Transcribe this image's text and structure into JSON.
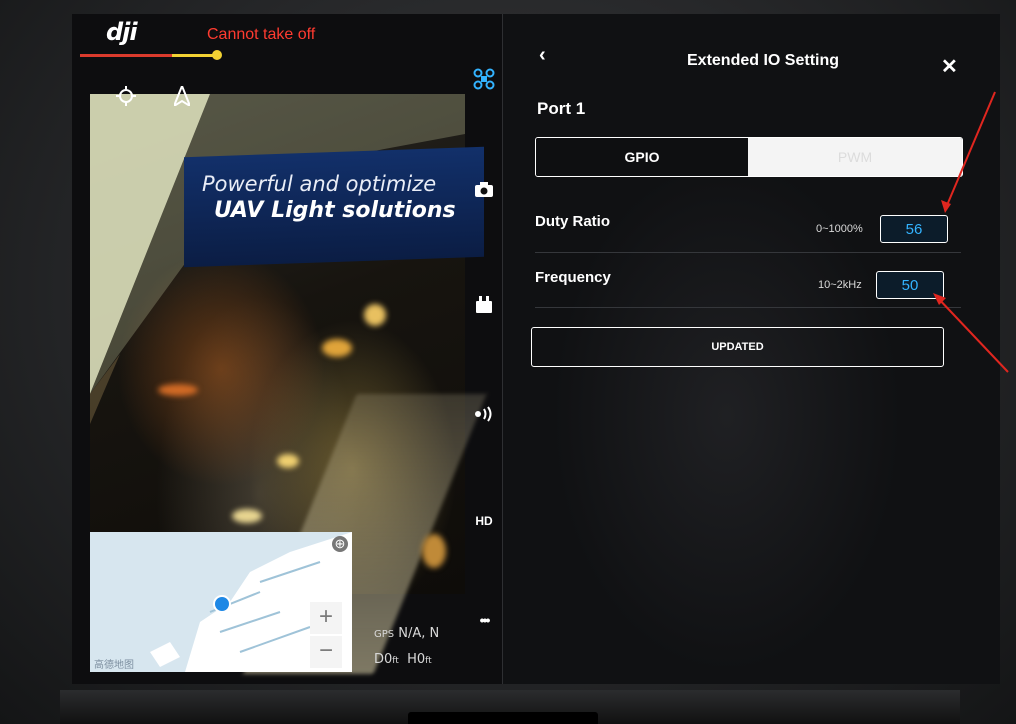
{
  "top_bar": {
    "logo": "dji",
    "status": "Cannot take off",
    "status_color": "#ff3b30"
  },
  "video": {
    "banner_line1": "Powerful and optimize",
    "banner_line2": "UAV Light solutions"
  },
  "sidebar_icons": [
    {
      "name": "aircraft-icon"
    },
    {
      "name": "camera-icon"
    },
    {
      "name": "battery-icon"
    },
    {
      "name": "signal-icon"
    },
    {
      "name": "hd-icon",
      "label": "HD"
    },
    {
      "name": "more-icon",
      "label": "•••"
    }
  ],
  "map": {
    "zoom_in": "+",
    "zoom_out": "−",
    "credit": "高德地图"
  },
  "telemetry": {
    "gps_label": "GPS",
    "gps_value": "N/A, N",
    "d_label": "D",
    "d_value": "0",
    "d_unit": "ft",
    "h_label": "H",
    "h_value": "0",
    "h_unit": "ft"
  },
  "panel": {
    "back": "‹",
    "title": "Extended IO Setting",
    "close": "✕",
    "port": "Port 1",
    "modes": [
      "GPIO",
      "PWM"
    ],
    "selected_mode": "GPIO",
    "duty": {
      "label": "Duty Ratio",
      "range": "0~1000%",
      "value": "56"
    },
    "frequency": {
      "label": "Frequency",
      "range": "10~2kHz",
      "value": "50"
    },
    "update_button": "UPDATED"
  },
  "colors": {
    "accent": "#33b3ff",
    "annotation": "#e0261f"
  }
}
